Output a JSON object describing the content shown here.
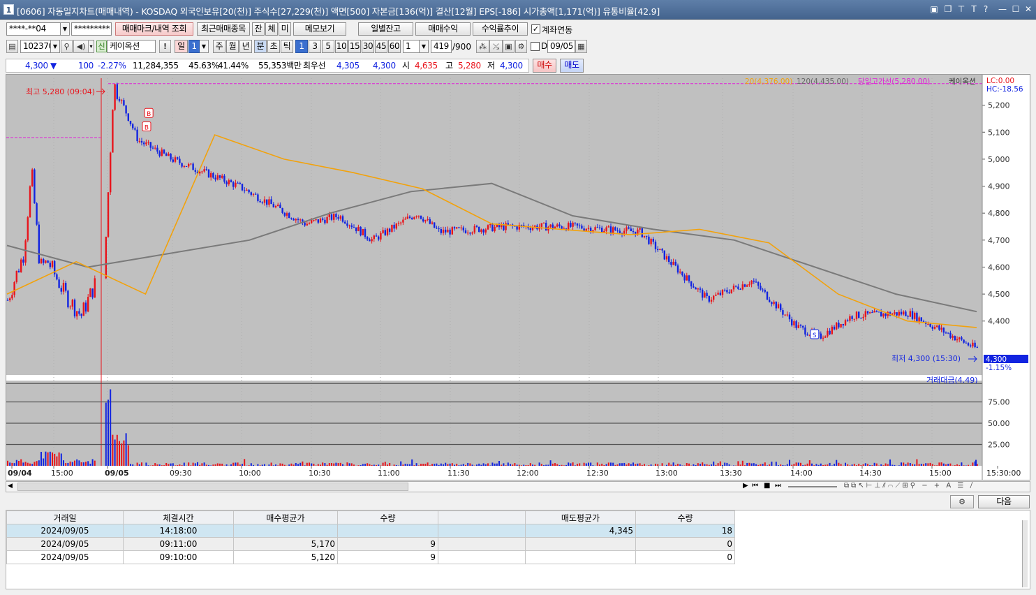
{
  "titlebar": {
    "window_num": "1",
    "title": "[0606] 자동일지차트(매매내역) - KOSDAQ 외국인보유[20(천)] 주식수[27,229(천)] 액면[500] 자본금[136(억)] 결산[12월] EPS[-186] 시가총액[1,171(억)] 유통비율[42.9]",
    "icons": [
      "restore-icon",
      "pin-icon",
      "text-icon",
      "help-icon",
      "minimize-icon",
      "maximize-icon",
      "close-icon"
    ]
  },
  "toolbar1": {
    "account": "****-**04",
    "password": "*********",
    "btn_trade_mark": "매매마크/내역 조회",
    "btn_recent": "최근매매종목",
    "btn_jan": "잔",
    "btn_che": "체",
    "btn_mi": "미",
    "btn_memo": "메모보기",
    "btn_daily_balance": "일별잔고",
    "btn_trade_profit": "매매수익",
    "btn_return_trend": "수익률추이",
    "account_link_label": "계좌연동",
    "account_link_checked": true
  },
  "toolbar2": {
    "code": "102370",
    "market_badge": "신",
    "name": "케이옥션",
    "periods": [
      "일",
      "1"
    ],
    "period_tabs": [
      "주",
      "월",
      "년",
      "분",
      "초",
      "틱"
    ],
    "interval_values": [
      "1",
      "3",
      "5",
      "10",
      "15",
      "30",
      "45",
      "60"
    ],
    "count_value": "1",
    "range": "419",
    "range_max": "/900",
    "d_label": "D",
    "date": "09/05"
  },
  "quote": {
    "price": "4,300",
    "arrow": "▼",
    "change": "100",
    "change_pct": "-2.27%",
    "volume": "11,284,355",
    "vol_pct1": "45.63%",
    "vol_pct2": "41.44%",
    "amount": "55,353백만",
    "best_label": "최우선",
    "best_ask": "4,305",
    "best_bid": "4,300",
    "open_label": "시",
    "open": "4,635",
    "high_label": "고",
    "high": "5,280",
    "low_label": "저",
    "low": "4,300",
    "buy_btn": "매수",
    "sell_btn": "매도"
  },
  "chart_labels": {
    "legend_ma20": "20(4,376.00)",
    "legend_ma120": "120(4,435.00)",
    "legend_high_line": "당일고가선(5,280.00)",
    "legend_name": "케이옥션",
    "lc": "LC:0.00",
    "hc": "HC:-18.56",
    "max_label": "최고 5,280 (09:04)",
    "min_label": "최저 4,300 (15:30)",
    "last_price_tag": "4,300",
    "last_pct_tag": "-1.15%",
    "buy_marker": "B",
    "sell_marker": "S",
    "volume_legend": "거래대금(4.49)",
    "price_ticks": [
      "5,200",
      "5,100",
      "5,000",
      "4,900",
      "4,800",
      "4,700",
      "4,600",
      "4,500",
      "4,400"
    ],
    "volume_ticks": [
      "75.00",
      "50.00",
      "25.00"
    ],
    "time_ticks": [
      "09/04",
      "15:00",
      "09/05",
      "09:30",
      "10:00",
      "10:30",
      "11:00",
      "11:30",
      "12:00",
      "12:30",
      "13:00",
      "13:30",
      "14:00",
      "14:30",
      "15:00",
      "15:30:00"
    ]
  },
  "table_controls": {
    "next_btn": "다음"
  },
  "trade_table": {
    "headers": [
      "거래일",
      "체결시간",
      "매수평균가",
      "수량",
      "",
      "매도평균가",
      "수량"
    ],
    "rows": [
      [
        "2024/09/05",
        "14:18:00",
        "",
        "",
        "",
        "4,345",
        "18"
      ],
      [
        "2024/09/05",
        "09:11:00",
        "5,170",
        "9",
        "",
        "",
        "0"
      ],
      [
        "2024/09/05",
        "09:10:00",
        "5,120",
        "9",
        "",
        "",
        "0"
      ]
    ]
  },
  "chart_data": {
    "type": "candlestick",
    "title": "케이옥션",
    "xlabel": "",
    "ylabel": "",
    "ylim": [
      4200,
      5300
    ],
    "volume_ylim": [
      0,
      100
    ],
    "grid": true,
    "colors": {
      "up": "#e8141c",
      "down": "#1224e0",
      "ma20": "#f2a20c",
      "ma120": "#7a7a7a",
      "high_line": "#e020d8"
    },
    "series": [
      {
        "name": "price_path",
        "x": [
          "09/04 14:35",
          "09/04 14:45",
          "09/04 14:50",
          "09/04 14:55",
          "09/04 15:00",
          "09/04 15:10",
          "09/04 15:20",
          "09/05 09:00",
          "09/05 09:04",
          "09/05 09:15",
          "09/05 09:30",
          "09/05 10:00",
          "09/05 10:30",
          "09/05 10:45",
          "09/05 11:00",
          "09/05 11:20",
          "09/05 11:30",
          "09/05 12:00",
          "09/05 12:30",
          "09/05 13:00",
          "09/05 13:30",
          "09/05 13:50",
          "09/05 14:10",
          "09/05 14:20",
          "09/05 14:35",
          "09/05 15:00",
          "09/05 15:30"
        ],
        "values": [
          4470,
          4650,
          4950,
          4600,
          4620,
          4500,
          4420,
          4620,
          5280,
          5070,
          5000,
          4900,
          4760,
          4790,
          4700,
          4800,
          4730,
          4750,
          4750,
          4730,
          4480,
          4550,
          4380,
          4340,
          4420,
          4430,
          4300
        ]
      },
      {
        "name": "20",
        "values": [
          4500,
          4620,
          4500,
          5090,
          5000,
          4950,
          4890,
          4760,
          4740,
          4720,
          4740,
          4690,
          4500,
          4400,
          4376
        ]
      },
      {
        "name": "120",
        "values": [
          4680,
          4600,
          4650,
          4700,
          4800,
          4880,
          4910,
          4790,
          4740,
          4700,
          4600,
          4500,
          4435
        ]
      }
    ],
    "high_line": 5280,
    "trades": [
      {
        "side": "B",
        "time": "09:10",
        "price": 5120
      },
      {
        "side": "B",
        "time": "09:11",
        "price": 5170
      },
      {
        "side": "S",
        "time": "14:18",
        "price": 4345
      }
    ]
  }
}
